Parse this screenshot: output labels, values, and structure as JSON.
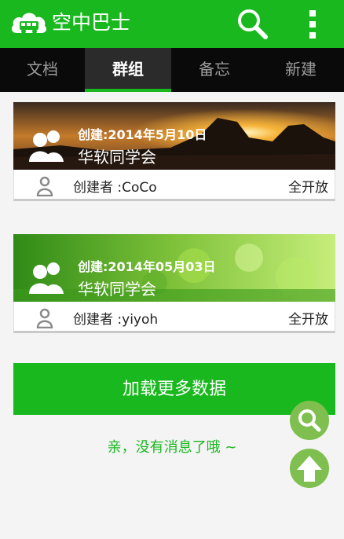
{
  "app": {
    "title": "空中巴士",
    "brand_color": "#19b81e"
  },
  "toolbar": {
    "search_icon": "search-icon",
    "more_icon": "overflow-menu-icon"
  },
  "tabs": [
    {
      "label": "文档",
      "active": false
    },
    {
      "label": "群组",
      "active": true
    },
    {
      "label": "备忘",
      "active": false
    },
    {
      "label": "新建",
      "active": false
    }
  ],
  "groups": [
    {
      "created": "创建:2014年5月10日",
      "name": "华软同学会",
      "creator": "创建者 :CoCo",
      "visibility": "全开放",
      "banner_theme": "sunset"
    },
    {
      "created": "创建:2014年05月03日",
      "name": "华软同学会",
      "creator": "创建者 :yiyoh",
      "visibility": "全开放",
      "banner_theme": "green-moss"
    }
  ],
  "load_more_label": "加载更多数据",
  "empty_message": "亲，没有消息了哦 ~",
  "fabs": {
    "search_icon": "search-icon",
    "top_icon": "arrow-up-icon"
  }
}
